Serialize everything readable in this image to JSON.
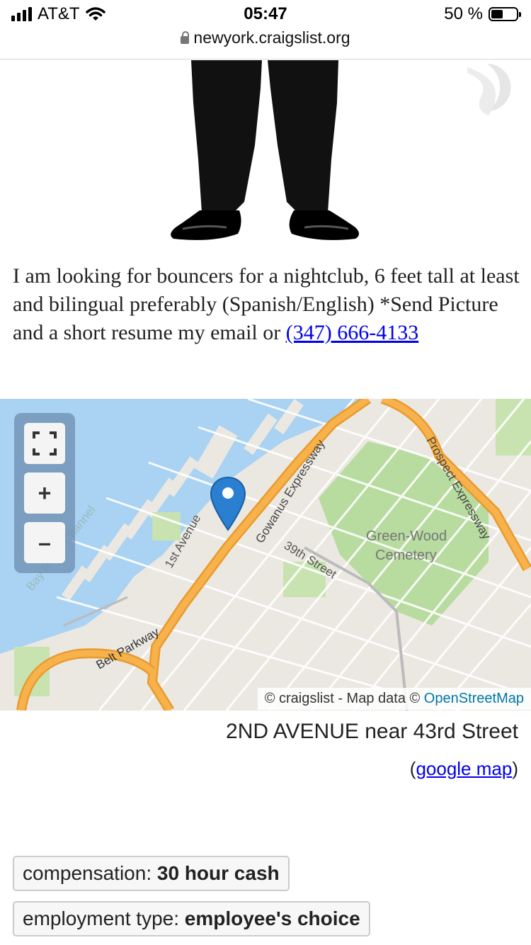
{
  "status_bar": {
    "carrier": "AT&T",
    "time": "05:47",
    "battery": "50 %",
    "battery_level": 0.5
  },
  "url_bar": {
    "domain": "newyork.craigslist.org"
  },
  "posting": {
    "body_text": "I am looking for bouncers for a nightclub, 6 feet tall at least and bilingual preferably (Spanish/English) *Send Picture and a short resume my email or ",
    "phone_link": "(347) 666-4133"
  },
  "map": {
    "labels": {
      "gowanus": "Gowanus Expressway",
      "prospect": "Prospect Expressway",
      "greenwood_1": "Green-Wood",
      "greenwood_2": "Cemetery",
      "first_ave": "1st Avenue",
      "street_39": "39th Street",
      "belt": "Belt Parkway",
      "channel": "Bay Ridge Channel"
    },
    "controls": {
      "fullscreen": "fullscreen-icon",
      "zoom_in": "+",
      "zoom_out": "–"
    },
    "attribution_prefix": "© craigslist - Map data © ",
    "attribution_link": "OpenStreetMap"
  },
  "location": {
    "address": "2ND AVENUE near 43rd Street",
    "paren_open": "(",
    "google_map_link": "google map",
    "paren_close": ")"
  },
  "attributes": [
    {
      "label": "compensation: ",
      "value": "30 hour cash"
    },
    {
      "label": "employment type: ",
      "value": "employee's choice"
    }
  ]
}
